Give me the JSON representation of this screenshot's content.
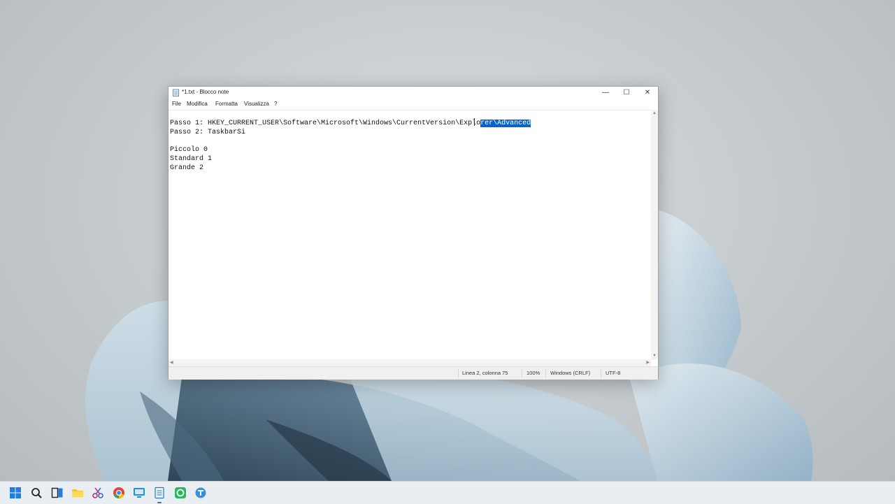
{
  "window": {
    "title": "*1.txt - Blocco note",
    "minimize_label": "—",
    "maximize_label": "☐",
    "close_label": "✕"
  },
  "menu": {
    "items": [
      "File",
      "Modifica",
      "Formatta",
      "Visualizza",
      "?"
    ]
  },
  "editor": {
    "line1_before": "Passo 1: HKEY_CURRENT_USER\\Software\\Microsoft\\Windows\\CurrentVersion\\Explo",
    "line1_selected": "rer\\Advanced",
    "line2": "Passo 2: TaskbarSi",
    "line3": "",
    "line4": "Piccolo 0",
    "line5": "Standard 1",
    "line6": "Grande 2"
  },
  "statusbar": {
    "position": "Linea 2, colonna 75",
    "zoom": "100%",
    "line_ending": "Windows (CRLF)",
    "encoding": "UTF-8"
  },
  "taskbar": {
    "icons": [
      "start-icon",
      "search-icon",
      "task-view-icon",
      "file-explorer-icon",
      "snipping-tool-icon",
      "chrome-icon",
      "remote-desktop-icon",
      "notepad-icon",
      "xbox-icon",
      "teams-icon"
    ]
  },
  "colors": {
    "selection": "#0a64c8",
    "taskbar": "#e9eef2"
  }
}
